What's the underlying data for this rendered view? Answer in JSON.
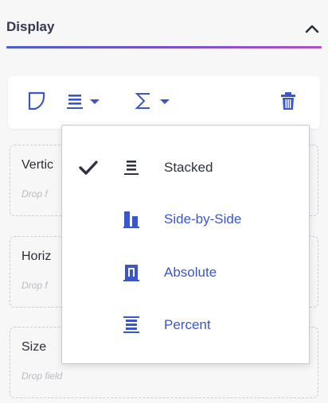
{
  "section": {
    "title": "Display"
  },
  "toolbar": {
    "buttons": [
      {
        "icon": "chart-shape-icon"
      },
      {
        "icon": "stacked-icon"
      },
      {
        "icon": "sigma-icon"
      },
      {
        "icon": "trash-icon"
      }
    ]
  },
  "zones": [
    {
      "label": "Vertic",
      "drop": "Drop f"
    },
    {
      "label": "Horiz",
      "drop": "Drop f"
    },
    {
      "label": "Size",
      "drop": "Drop field"
    }
  ],
  "menu": {
    "items": [
      {
        "label": "Stacked",
        "selected": true,
        "icon": "stacked-icon"
      },
      {
        "label": "Side-by-Side",
        "selected": false,
        "icon": "side-by-side-icon"
      },
      {
        "label": "Absolute",
        "selected": false,
        "icon": "absolute-icon"
      },
      {
        "label": "Percent",
        "selected": false,
        "icon": "percent-icon"
      }
    ]
  },
  "colors": {
    "accent": "#3f51b5",
    "selected_text": "#2e3340",
    "icon_blue": "#3a56c9",
    "gradient_start": "#4a5fd0",
    "gradient_end": "#b14fc9"
  }
}
